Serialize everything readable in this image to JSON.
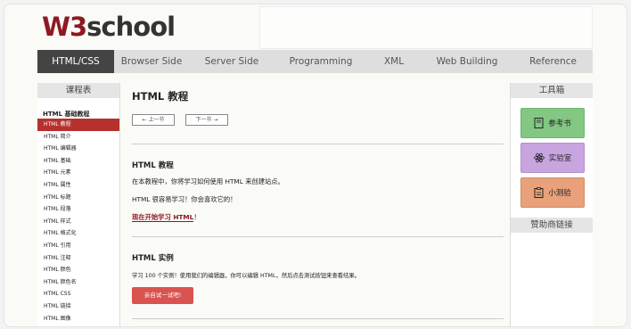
{
  "logo": {
    "w3": "W3",
    "school": "school"
  },
  "nav": {
    "items": [
      "HTML/CSS",
      "Browser Side",
      "Server Side",
      "Programming",
      "XML",
      "Web Building",
      "Reference"
    ],
    "active_index": 0
  },
  "left": {
    "title": "课程表",
    "section": "HTML 基础教程",
    "items": [
      "HTML 教程",
      "HTML 简介",
      "HTML 编辑器",
      "HTML 基础",
      "HTML 元素",
      "HTML 属性",
      "HTML 标题",
      "HTML 段落",
      "HTML 样式",
      "HTML 格式化",
      "HTML 引用",
      "HTML 注释",
      "HTML 颜色",
      "HTML 颜色名",
      "HTML CSS",
      "HTML 链接",
      "HTML 图像"
    ],
    "active_index": 0
  },
  "main": {
    "title": "HTML 教程",
    "prev": "上一节",
    "next": "下一节",
    "section1": {
      "heading": "HTML 教程",
      "p1": "在本教程中，你将学习如何使用 HTML 来创建站点。",
      "p2": "HTML 很容易学习！你会喜欢它的！",
      "link": "现在开始学习 HTML",
      "link_suffix": "！"
    },
    "section2": {
      "heading": "HTML 实例",
      "p1": "学习 100 个实例！使用我们的编辑器，你可以编辑 HTML，然后点击测试按钮来查看结果。",
      "try_button": "亲自试一试吧!"
    }
  },
  "right": {
    "title": "工具箱",
    "tools": [
      {
        "label": "参考书",
        "icon": "book-icon",
        "color": "#82c782"
      },
      {
        "label": "实验室",
        "icon": "atom-icon",
        "color": "#c9a5e0"
      },
      {
        "label": "小测验",
        "icon": "quiz-icon",
        "color": "#e8a17a"
      }
    ],
    "sponsor_title": "赞助商链接"
  },
  "colors": {
    "brand": "#8c1a20",
    "nav_active": "#444444",
    "left_active": "#b6312d",
    "try_button": "#d9534f"
  }
}
